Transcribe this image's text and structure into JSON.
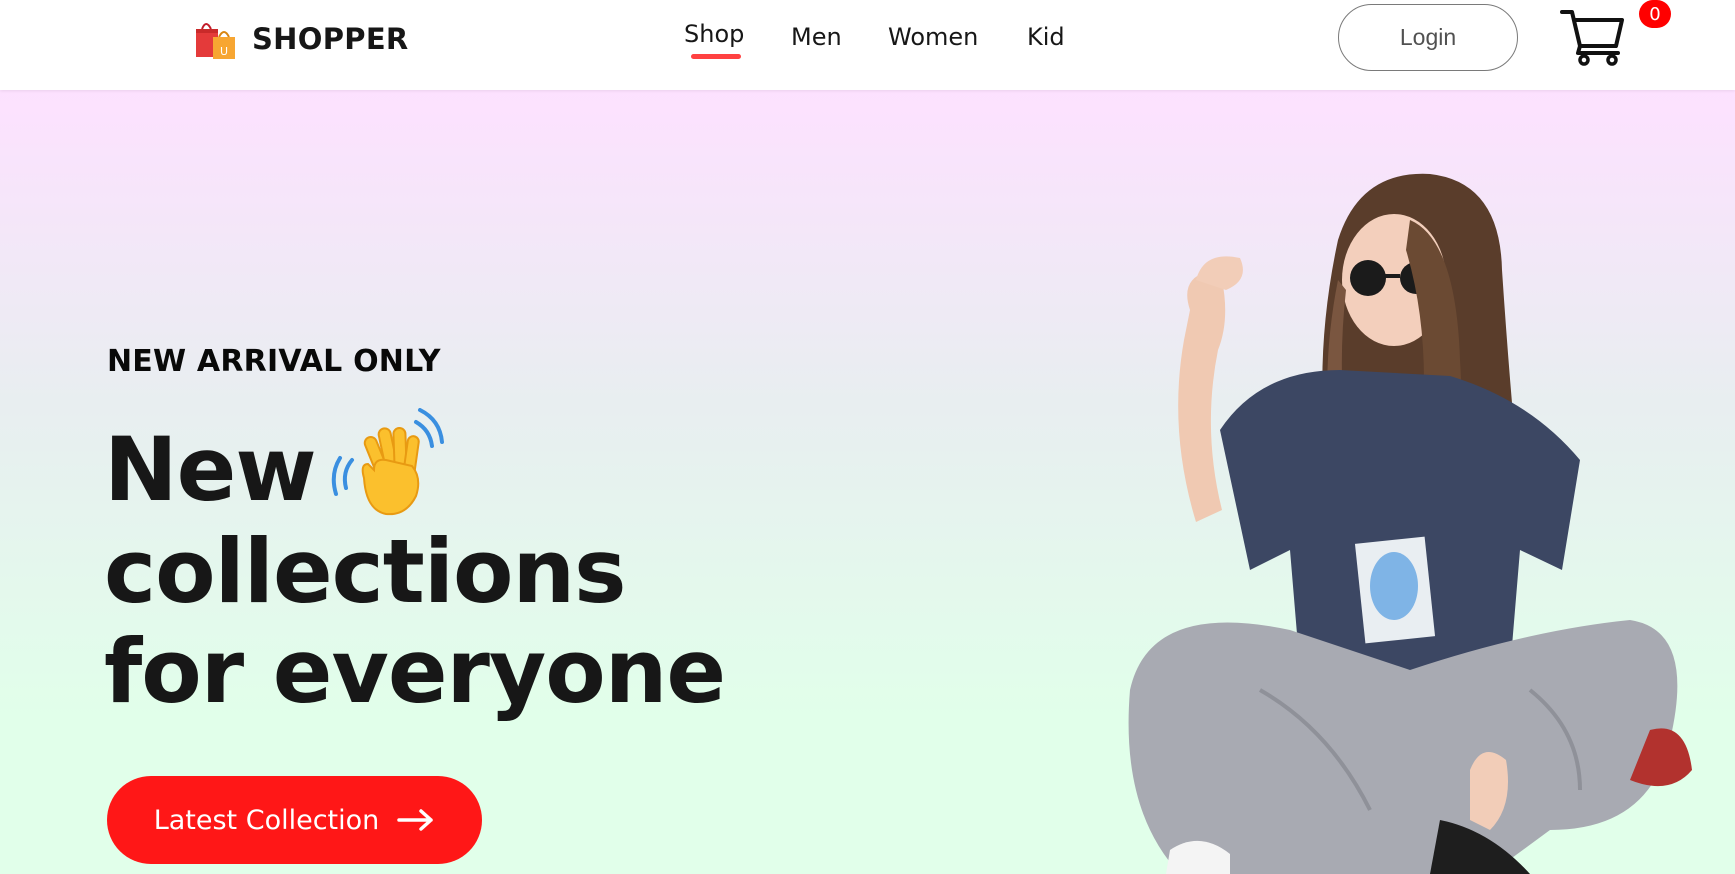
{
  "navbar": {
    "brand": {
      "logo_icon": "shopping-bags-icon",
      "name": "SHOPPER"
    },
    "menu": [
      {
        "label": "Shop",
        "active": true
      },
      {
        "label": "Men",
        "active": false
      },
      {
        "label": "Women",
        "active": false
      },
      {
        "label": "Kid",
        "active": false
      }
    ],
    "login_label": "Login",
    "cart": {
      "icon": "shopping-cart-icon",
      "count": "0"
    }
  },
  "hero": {
    "tagline": "NEW ARRIVAL ONLY",
    "headline": {
      "line1": "New",
      "line2": "collections",
      "line3": "for everyone",
      "emoji_icon": "waving-hand-icon"
    },
    "cta_label": "Latest Collection",
    "cta_icon": "arrow-right-icon",
    "image_icon": "hero-model-image"
  },
  "colors": {
    "accent": "#ff4141",
    "cta": "#ff1717",
    "badge": "#ff0000",
    "gradient_top": "#fde1ff",
    "gradient_bottom": "#e1ffea"
  }
}
